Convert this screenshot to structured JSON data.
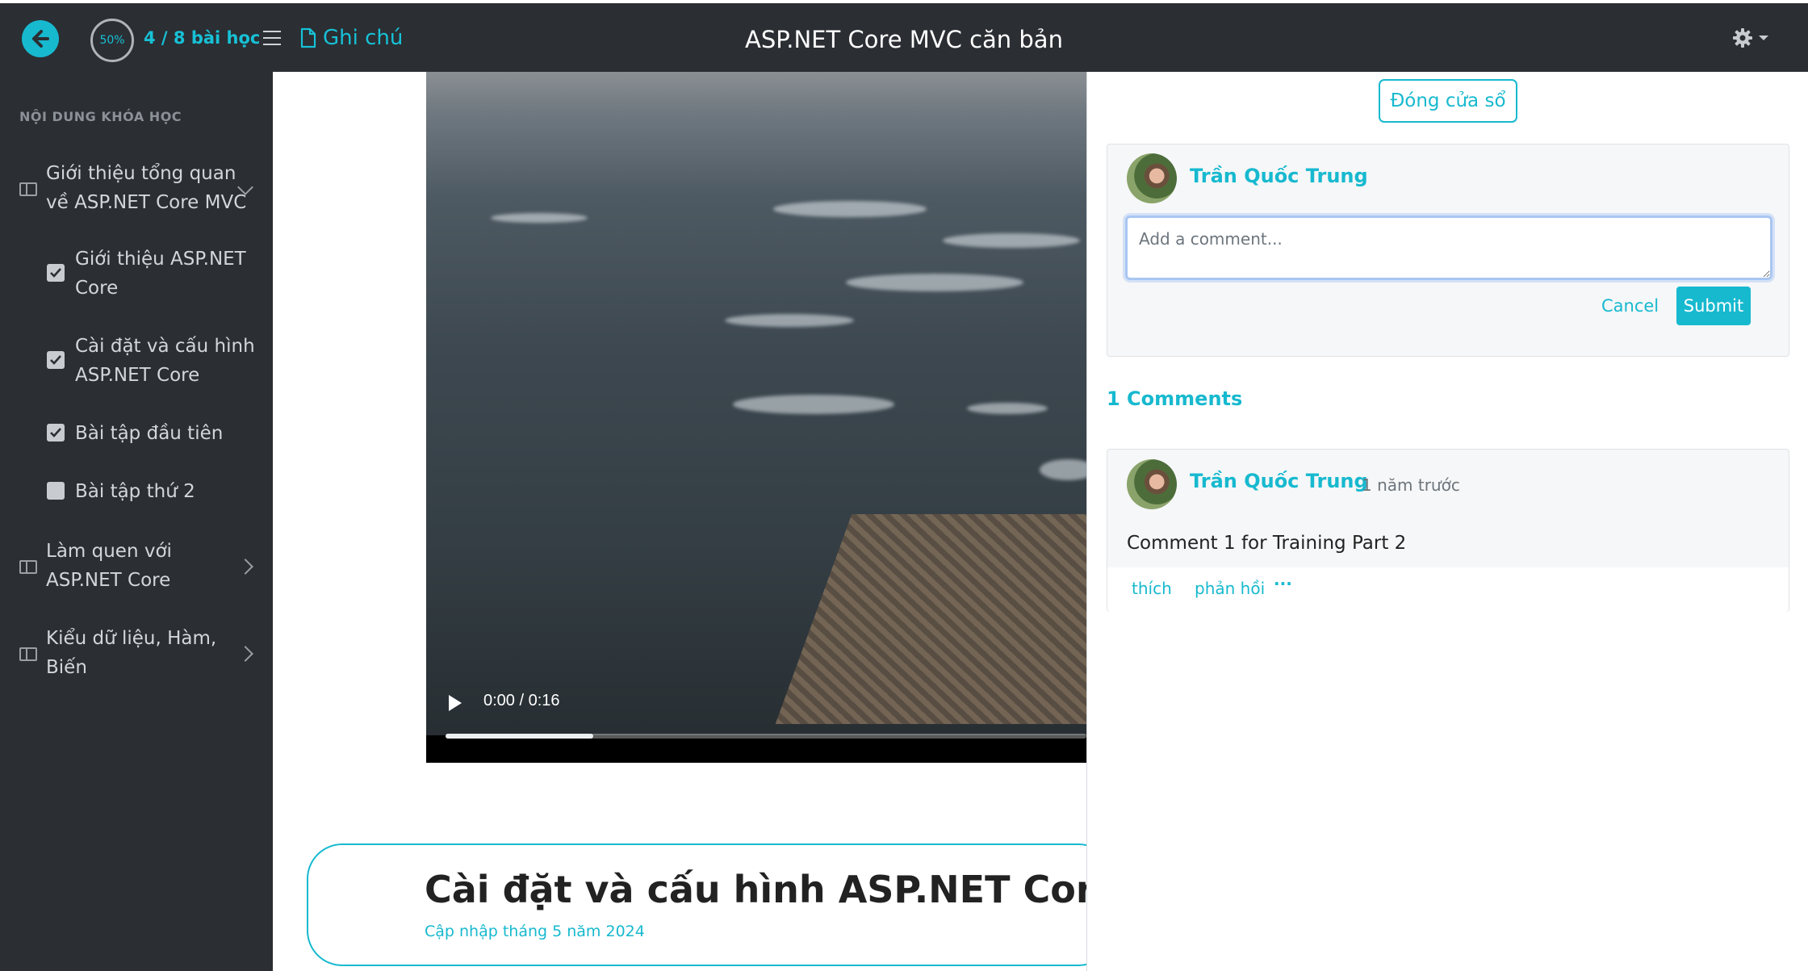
{
  "header": {
    "progress_percent": "50%",
    "lesson_count": "4 / 8 bài học",
    "note_label": "Ghi chú",
    "course_title": "ASP.NET Core MVC căn bản"
  },
  "sidebar": {
    "heading": "NỘI DUNG KHÓA HỌC",
    "chapters": [
      {
        "label": "Giới thiệu tổng quan về ASP.NET Core MVC",
        "expanded": true,
        "lessons": [
          {
            "label": "Giới thiệu ASP.NET Core",
            "checked": true
          },
          {
            "label": "Cài đặt và cấu hình ASP.NET Core",
            "checked": true
          },
          {
            "label": "Bài tập đầu tiên",
            "checked": true
          },
          {
            "label": "Bài tập thứ 2",
            "checked": false
          }
        ]
      },
      {
        "label": "Làm quen với ASP.NET Core",
        "expanded": false
      },
      {
        "label": "Kiểu dữ liệu, Hàm, Biến",
        "expanded": false
      }
    ]
  },
  "video": {
    "time": "0:00 / 0:16",
    "progress": 0.23
  },
  "lesson": {
    "title": "Cài đặt và cấu hình ASP.NET Core",
    "updated": "Cập nhập tháng 5 năm 2024"
  },
  "comments_panel": {
    "close_label": "Đóng cửa sổ",
    "current_user": "Trần Quốc Trung",
    "input_placeholder": "Add a comment...",
    "cancel_label": "Cancel",
    "submit_label": "Submit",
    "count_label": "1 Comments",
    "items": [
      {
        "author": "Trần Quốc Trung",
        "time_ago": "1 năm trước",
        "text": "Comment 1 for Training Part 2",
        "like_label": "thích",
        "reply_label": "phản hồi",
        "more_label": "···"
      }
    ]
  },
  "colors": {
    "accent": "#17b9cf",
    "dark": "#2b2e33"
  }
}
